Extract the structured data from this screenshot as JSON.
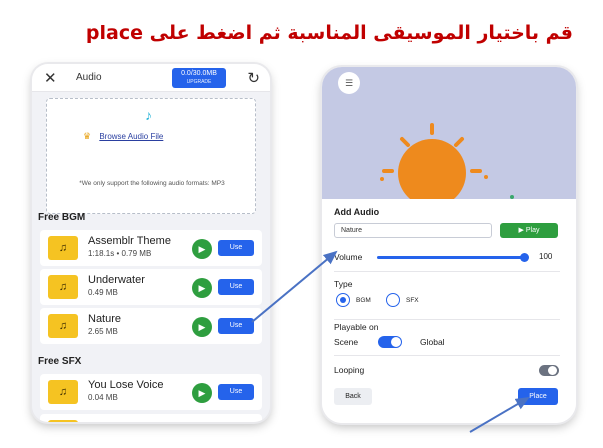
{
  "instruction": "قم باختيار الموسيقى المناسبة ثم اضغط على place",
  "left_panel": {
    "close_glyph": "✕",
    "title": "Audio",
    "storage_value": "0.0/30.0MB",
    "storage_upgrade": "UPGRADE",
    "refresh_glyph": "↻",
    "browse_label": "Browse Audio File",
    "support_text": "*We only support the following audio formats: MP3",
    "bgm_heading": "Free BGM",
    "sfx_heading": "Free SFX",
    "bgm_tracks": [
      {
        "name": "Assemblr Theme",
        "meta": "1:18.1s • 0.79 MB",
        "use_label": "Use"
      },
      {
        "name": "Underwater",
        "meta": "0.49 MB",
        "use_label": "Use"
      },
      {
        "name": "Nature",
        "meta": "2.65 MB",
        "use_label": "Use"
      }
    ],
    "sfx_tracks": [
      {
        "name": "You Lose Voice",
        "meta": "0.04 MB",
        "use_label": "Use"
      }
    ],
    "thumb_glyph": "♫",
    "play_glyph": "▶"
  },
  "right_panel": {
    "menu_glyph": "☰",
    "heading": "Add Audio",
    "audio_name": "Nature",
    "play_label": "▶  Play",
    "volume_label": "Volume",
    "volume_value": "100",
    "volume_fraction": 1.0,
    "type_label": "Type",
    "type_options": [
      "BGM",
      "SFX"
    ],
    "type_selected": "BGM",
    "playable_label": "Playable on",
    "scene_label": "Scene",
    "global_label": "Global",
    "looping_label": "Looping",
    "looping_on": false,
    "back_label": "Back",
    "place_label": "Place"
  },
  "colors": {
    "instruction": "#c00000",
    "accent_blue": "#2563eb",
    "play_green": "#2e9e3f",
    "thumb_yellow": "#f5c322",
    "sun_orange": "#ee8a1d",
    "scene_bg": "#c4c9e4",
    "arrow": "#4a72c4"
  }
}
